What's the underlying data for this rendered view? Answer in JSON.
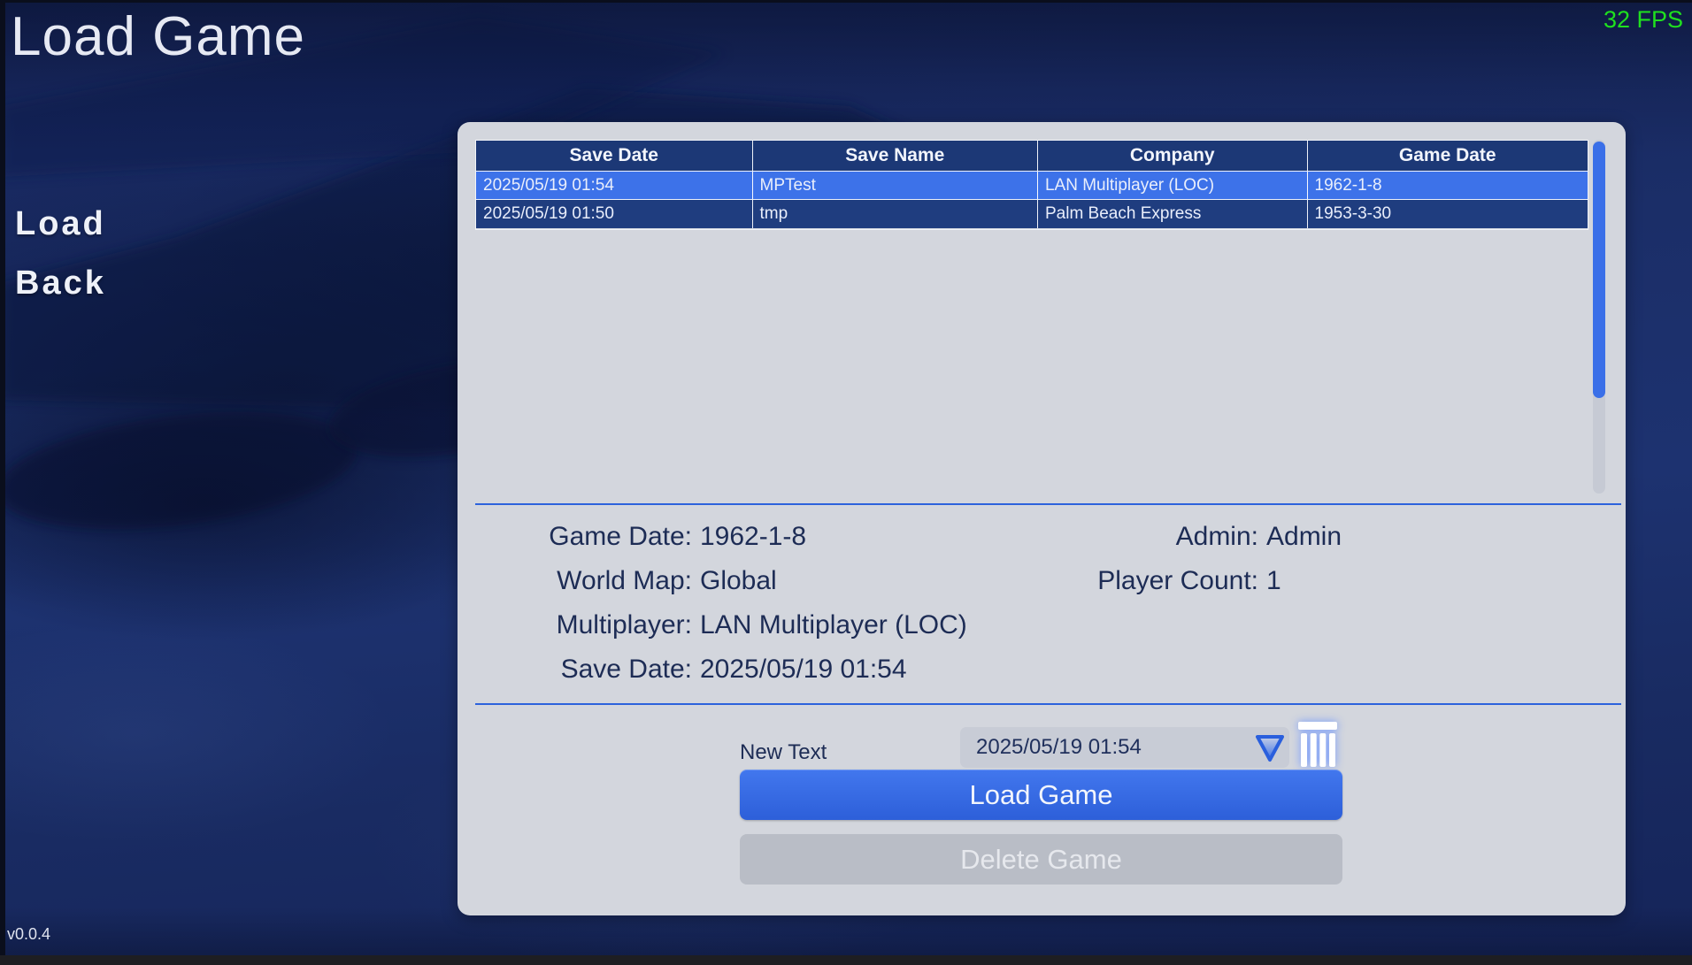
{
  "window": {
    "title": "Load Game",
    "fps": "32 FPS",
    "version": "v0.0.4"
  },
  "menu": {
    "items": [
      {
        "label": "Load"
      },
      {
        "label": "Back"
      }
    ]
  },
  "save_table": {
    "columns": [
      "Save Date",
      "Save Name",
      "Company",
      "Game Date"
    ],
    "rows": [
      {
        "save_date": "2025/05/19 01:54",
        "save_name": "MPTest",
        "company": "LAN Multiplayer (LOC)",
        "game_date": "1962-1-8",
        "selected": true
      },
      {
        "save_date": "2025/05/19 01:50",
        "save_name": "tmp",
        "company": "Palm Beach Express",
        "game_date": "1953-3-30",
        "selected": false
      }
    ]
  },
  "details": {
    "left": [
      {
        "label": "Game Date:",
        "value": "1962-1-8"
      },
      {
        "label": "World Map:",
        "value": "Global"
      },
      {
        "label": "Multiplayer:",
        "value": "LAN Multiplayer (LOC)"
      },
      {
        "label": "Save Date:",
        "value": "2025/05/19 01:54"
      }
    ],
    "right": [
      {
        "label": "Admin:",
        "value": "Admin"
      },
      {
        "label": "Player Count:",
        "value": "1"
      }
    ]
  },
  "form": {
    "new_text_label": "New Text",
    "save_name_value": "2025/05/19 01:54",
    "load_button_label": "Load Game",
    "delete_button_label": "Delete Game"
  },
  "icons": {
    "dropdown": "triangle-down-icon",
    "delete": "trash-icon"
  },
  "colors": {
    "selected_row_blue": "#3d72e9",
    "header_navy": "#1c3876",
    "row_navy": "#1f3d7f",
    "panel_bg": "#d3d6dd",
    "fps_green": "#1fe01f",
    "separator_blue": "#2c62dc",
    "details_navy": "#1d2c55",
    "button_blue": "#3569e3",
    "disabled_gray": "#b9bdc6"
  }
}
